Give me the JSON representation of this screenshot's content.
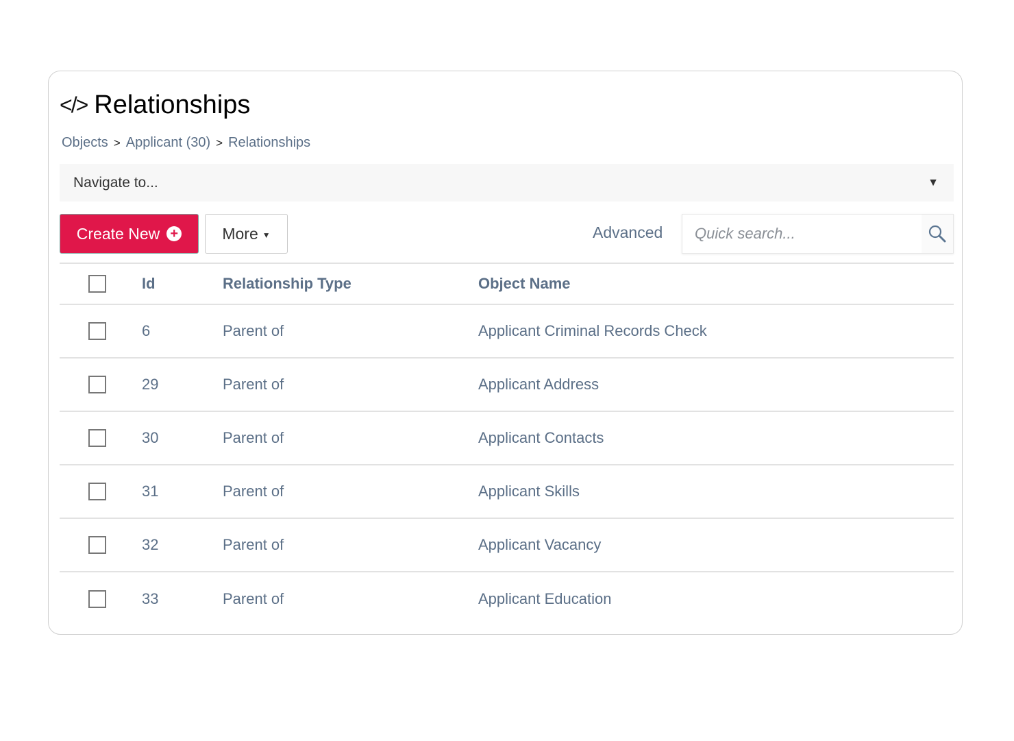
{
  "page": {
    "title": "Relationships",
    "title_icon": "code-icon",
    "breadcrumb": [
      {
        "label": "Objects"
      },
      {
        "label": "Applicant (30)"
      },
      {
        "label": "Relationships"
      }
    ],
    "breadcrumb_separator": ">"
  },
  "navigate": {
    "label": "Navigate to...",
    "caret": "▼"
  },
  "toolbar": {
    "create_label": "Create New",
    "create_icon": "+",
    "more_label": "More",
    "more_caret": "▼",
    "advanced_label": "Advanced",
    "search_placeholder": "Quick search...",
    "search_value": ""
  },
  "colors": {
    "primary": "#e0174a",
    "text_muted": "#5b6f87"
  },
  "table": {
    "columns": [
      "Id",
      "Relationship Type",
      "Object Name"
    ],
    "rows": [
      {
        "id": "6",
        "type": "Parent of",
        "name": "Applicant Criminal Records Check",
        "checked": false
      },
      {
        "id": "29",
        "type": "Parent of",
        "name": "Applicant Address",
        "checked": false
      },
      {
        "id": "30",
        "type": "Parent of",
        "name": "Applicant Contacts",
        "checked": false
      },
      {
        "id": "31",
        "type": "Parent of",
        "name": "Applicant Skills",
        "checked": false
      },
      {
        "id": "32",
        "type": "Parent of",
        "name": "Applicant Vacancy",
        "checked": false
      },
      {
        "id": "33",
        "type": "Parent of",
        "name": "Applicant Education",
        "checked": false
      }
    ]
  }
}
